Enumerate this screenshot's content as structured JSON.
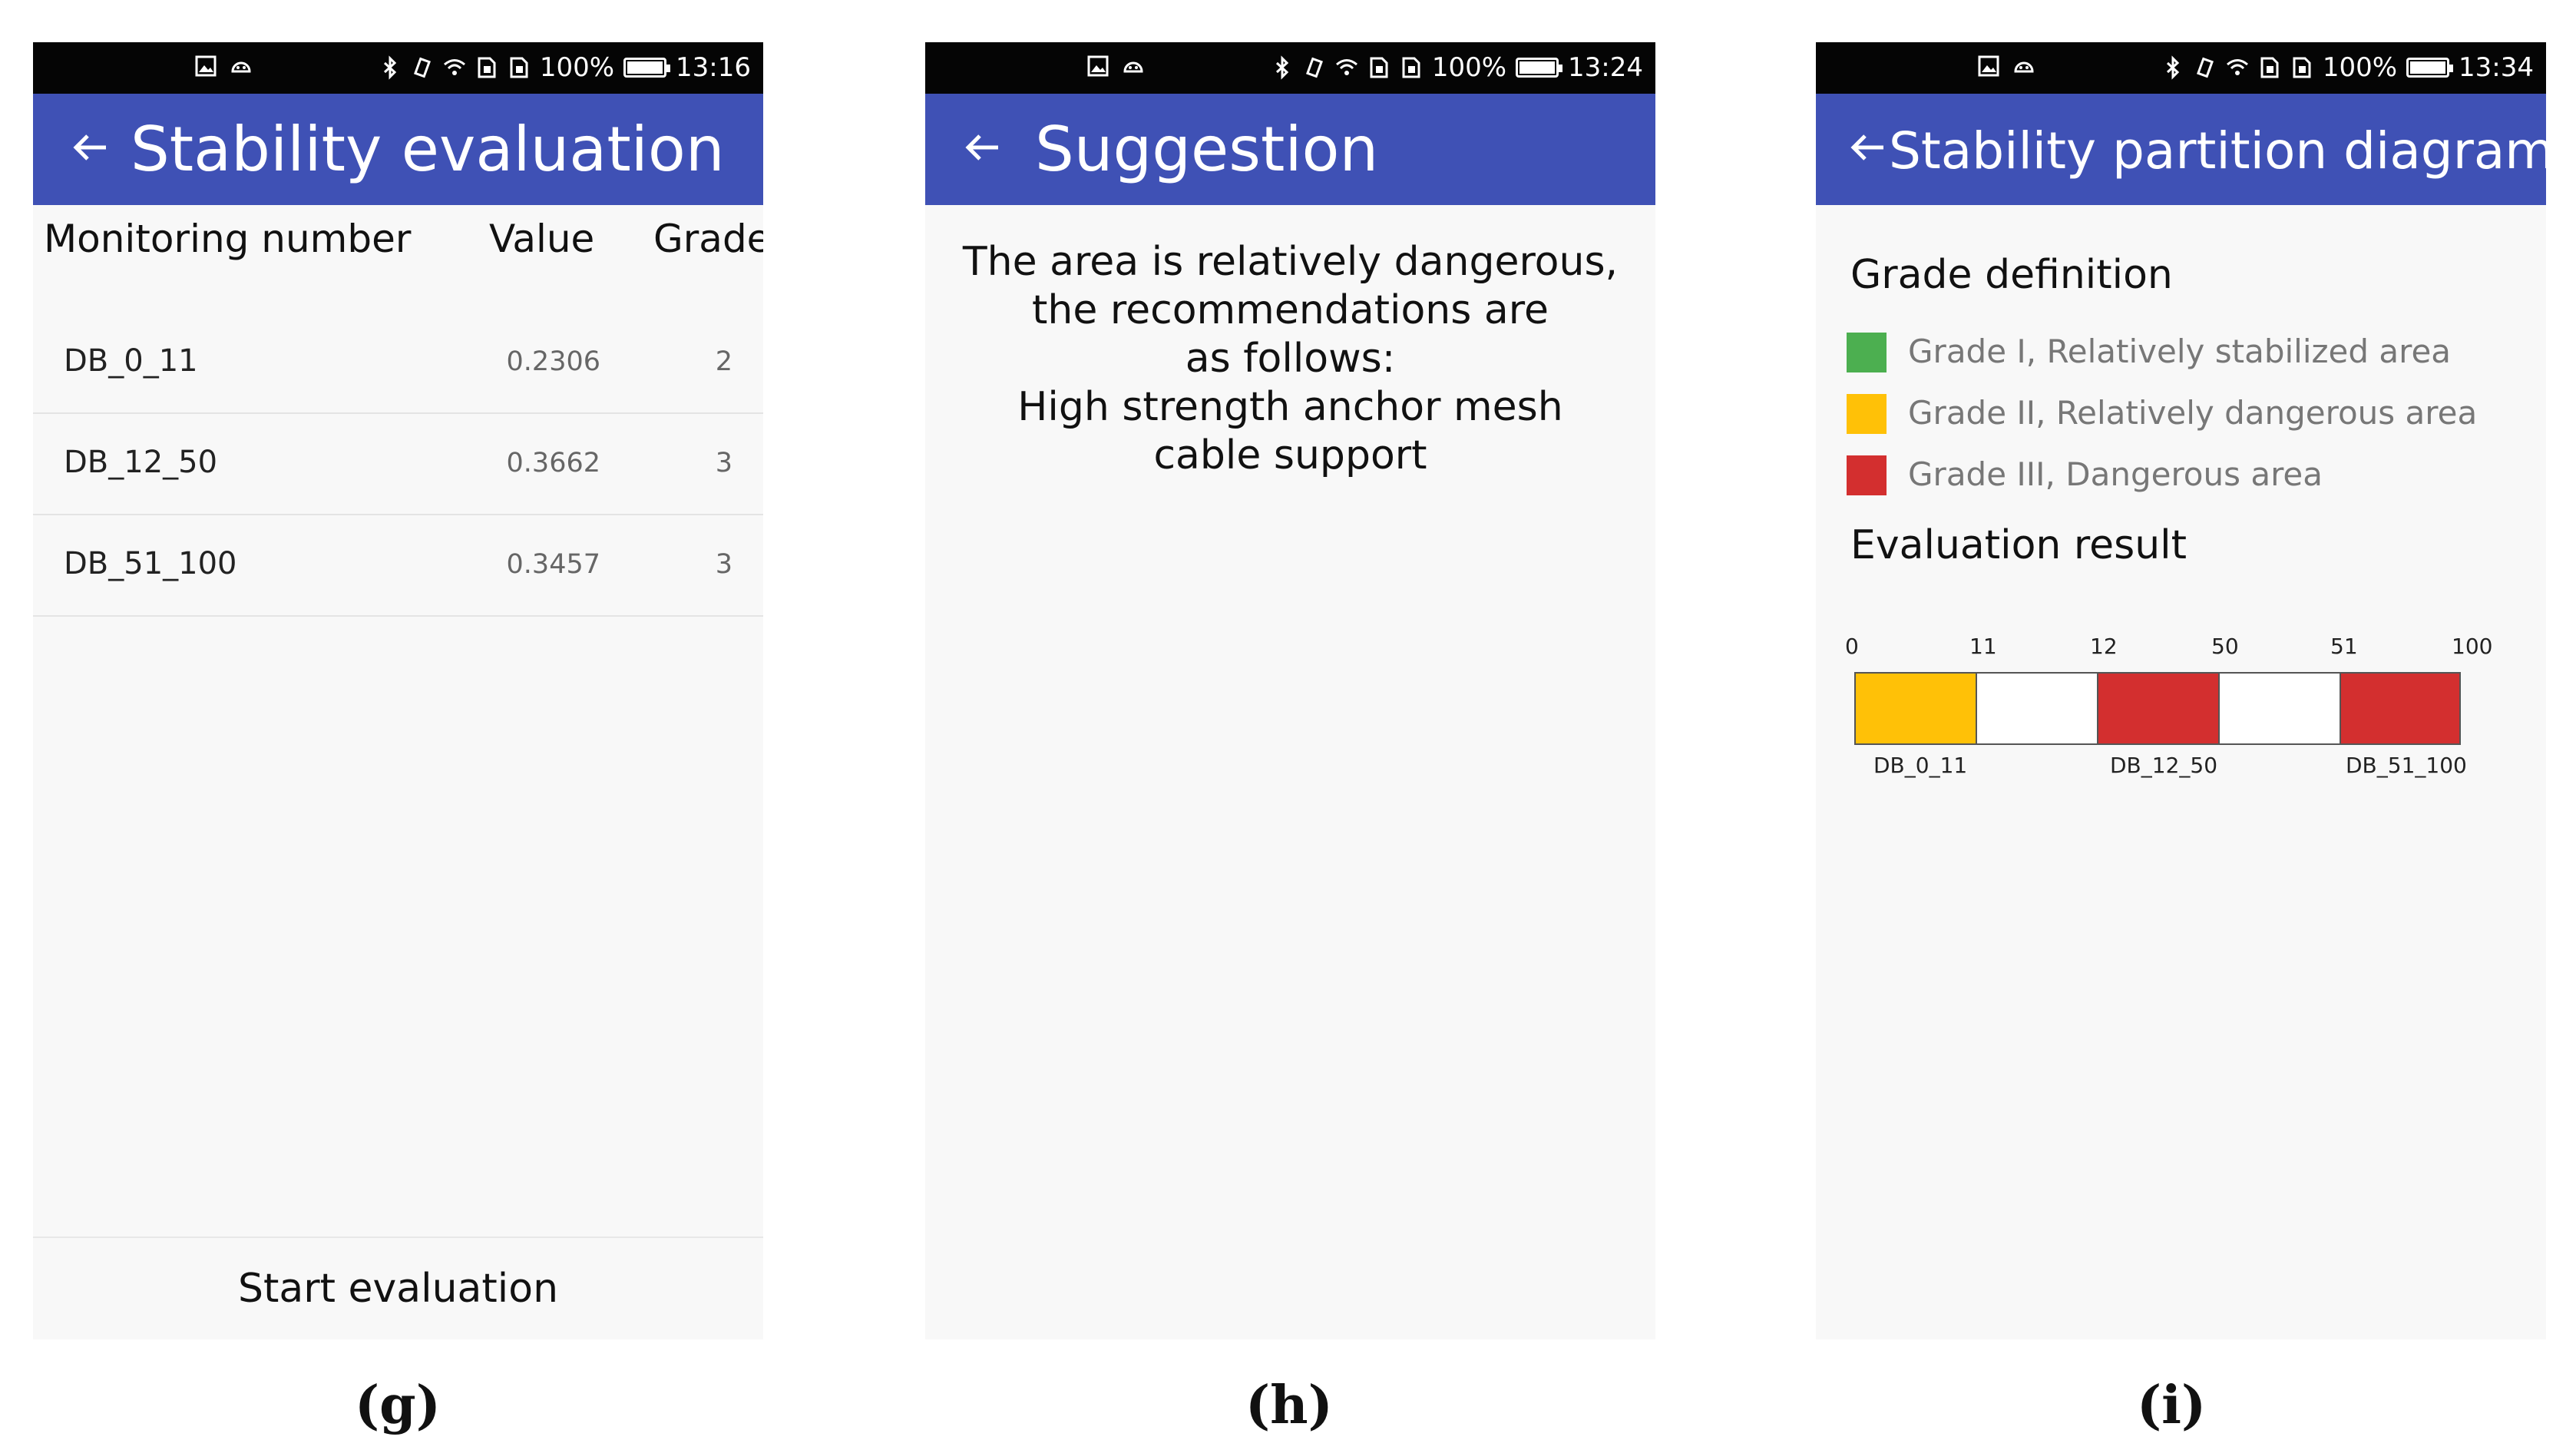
{
  "colors": {
    "appbar": "#3f51b5",
    "grade1": "#4caf50",
    "grade2": "#ffc107",
    "grade3": "#d32f2f"
  },
  "panels": {
    "g": {
      "status": {
        "battery": "100%",
        "time": "13:16"
      },
      "title": "Stability evaluation",
      "columns": {
        "name": "Monitoring number",
        "value": "Value",
        "grade": "Grade"
      },
      "rows": [
        {
          "name": "DB_0_11",
          "value": "0.2306",
          "grade": "2"
        },
        {
          "name": "DB_12_50",
          "value": "0.3662",
          "grade": "3"
        },
        {
          "name": "DB_51_100",
          "value": "0.3457",
          "grade": "3"
        }
      ],
      "button": "Start evaluation",
      "caption": "(g)"
    },
    "h": {
      "status": {
        "battery": "100%",
        "time": "13:24"
      },
      "title": "Suggestion",
      "lines": [
        "The area is relatively dangerous,",
        "the recommendations are",
        "as follows:",
        "High strength anchor mesh",
        "cable support"
      ],
      "caption": "(h)"
    },
    "i": {
      "status": {
        "battery": "100%",
        "time": "13:34"
      },
      "title": "Stability partition diagram",
      "grade_definition_title": "Grade definition",
      "grades": [
        {
          "label": "Grade I, Relatively stabilized area",
          "color": "#4caf50"
        },
        {
          "label": "Grade II, Relatively dangerous area",
          "color": "#ffc107"
        },
        {
          "label": "Grade III, Dangerous area",
          "color": "#d32f2f"
        }
      ],
      "result_title": "Evaluation result",
      "ticks": [
        "0",
        "11",
        "12",
        "50",
        "51",
        "100"
      ],
      "segments": [
        {
          "label": "DB_0_11",
          "start": 0,
          "end": 11,
          "grade": 2
        },
        {
          "label": "DB_12_50",
          "start": 12,
          "end": 50,
          "grade": 3
        },
        {
          "label": "DB_51_100",
          "start": 51,
          "end": 100,
          "grade": 3
        }
      ],
      "caption": "(i)"
    }
  }
}
